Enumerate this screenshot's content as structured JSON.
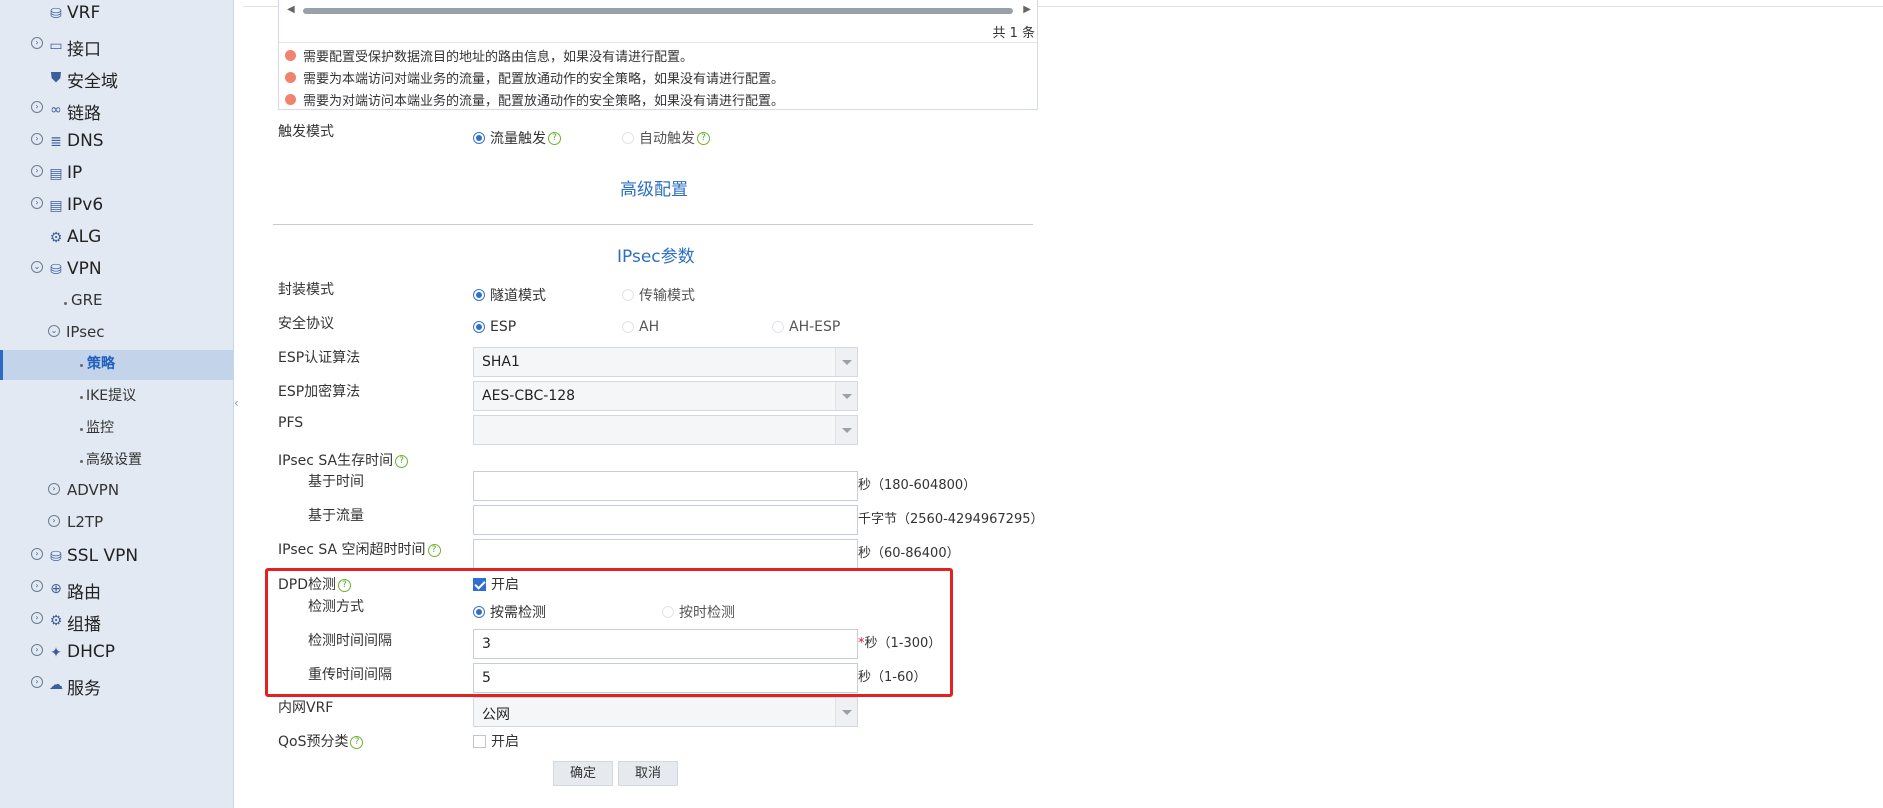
{
  "sidebar": {
    "items": [
      {
        "label": "VRF",
        "icon": "vrf-icon",
        "glyph": "⛁"
      },
      {
        "label": "接口",
        "icon": "interface-icon",
        "glyph": "▭"
      },
      {
        "label": "安全域",
        "icon": "shield-icon",
        "glyph": "⛊"
      },
      {
        "label": "链路",
        "icon": "link-icon",
        "glyph": "🔗"
      },
      {
        "label": "DNS",
        "icon": "dns-icon",
        "glyph": "≣"
      },
      {
        "label": "IP",
        "icon": "ip-icon",
        "glyph": "▤"
      },
      {
        "label": "IPv6",
        "icon": "ipv6-icon",
        "glyph": "▤"
      },
      {
        "label": "ALG",
        "icon": "alg-icon",
        "glyph": "⚙"
      },
      {
        "label": "VPN",
        "icon": "vpn-icon",
        "glyph": "⛁"
      },
      {
        "label": "GRE"
      },
      {
        "label": "IPsec"
      },
      {
        "label": "策略"
      },
      {
        "label": "IKE提议"
      },
      {
        "label": "监控"
      },
      {
        "label": "高级设置"
      },
      {
        "label": "ADVPN"
      },
      {
        "label": "L2TP"
      },
      {
        "label": "SSL VPN",
        "icon": "ssl-vpn-icon",
        "glyph": "⛁"
      },
      {
        "label": "路由",
        "icon": "route-icon",
        "glyph": "⊕"
      },
      {
        "label": "组播",
        "icon": "multicast-icon",
        "glyph": "⚙"
      },
      {
        "label": "DHCP",
        "icon": "dhcp-icon",
        "glyph": "✦"
      },
      {
        "label": "服务",
        "icon": "service-icon",
        "glyph": "☁"
      }
    ]
  },
  "table": {
    "total": "共 1 条"
  },
  "notes": [
    "需要配置受保护数据流目的地址的路由信息，如果没有请进行配置。",
    "需要为本端访问对端业务的流量，配置放通动作的安全策略，如果没有请进行配置。",
    "需要为对端访问本端业务的流量，配置放通动作的安全策略，如果没有请进行配置。"
  ],
  "trigger": {
    "label": "触发模式",
    "options": [
      "流量触发",
      "自动触发"
    ],
    "selected": "流量触发"
  },
  "advanced_title": "高级配置",
  "ipsec_title": "IPsec参数",
  "encap": {
    "label": "封装模式",
    "options": [
      "隧道模式",
      "传输模式"
    ],
    "selected": "隧道模式"
  },
  "protocol": {
    "label": "安全协议",
    "options": [
      "ESP",
      "AH",
      "AH-ESP"
    ],
    "selected": "ESP"
  },
  "esp_auth": {
    "label": "ESP认证算法",
    "value": "SHA1"
  },
  "esp_enc": {
    "label": "ESP加密算法",
    "value": "AES-CBC-128"
  },
  "pfs": {
    "label": "PFS",
    "value": ""
  },
  "sa_lifetime": {
    "label": "IPsec SA生存时间",
    "time_label": "基于时间",
    "time_value": "",
    "time_unit": "秒（180-604800）",
    "traffic_label": "基于流量",
    "traffic_value": "",
    "traffic_unit": "千字节（2560-4294967295）"
  },
  "sa_idle": {
    "label": "IPsec SA 空闲超时时间",
    "value": "",
    "unit": "秒（60-86400）"
  },
  "dpd": {
    "label": "DPD检测",
    "enable_label": "开启",
    "enabled": true,
    "mode_label": "检测方式",
    "mode_options": [
      "按需检测",
      "按时检测"
    ],
    "mode_selected": "按需检测",
    "interval_label": "检测时间间隔",
    "interval_value": "3",
    "interval_required": "*",
    "interval_unit": "秒（1-300）",
    "retry_label": "重传时间间隔",
    "retry_value": "5",
    "retry_unit": "秒（1-60）"
  },
  "inner_vrf": {
    "label": "内网VRF",
    "value": "公网"
  },
  "qos": {
    "label": "QoS预分类",
    "enable_label": "开启",
    "enabled": false
  },
  "buttons": {
    "ok": "确定",
    "cancel": "取消"
  },
  "colors": {
    "accent": "#2c6fc2",
    "highlight_border": "#e3211e",
    "note_bullet": "#f0826e",
    "help": "#5aa525"
  }
}
